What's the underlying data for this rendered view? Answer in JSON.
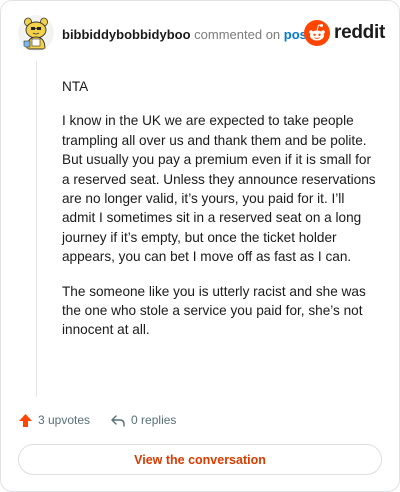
{
  "comment": {
    "username": "bibbiddybobbidyboo",
    "action_text": "commented on",
    "post_link": "post",
    "paragraphs": [
      "NTA",
      "I know in the UK we are expected to take people trampling all over us and thank them and be polite. But usually you pay a premium even if it is small for a reserved seat. Unless they announce reservations are no longer valid, it’s yours, you paid for it. I’ll admit I sometimes sit in a reserved seat on a long journey if it’s empty, but once the ticket holder appears, you can bet I move off as fast as I can.",
      "The someone like you is utterly racist and she was the one who stole a service you paid for, she’s not innocent at all."
    ]
  },
  "brand": {
    "wordmark": "reddit",
    "color": "#ff4500"
  },
  "actions": {
    "upvotes": "3 upvotes",
    "replies": "0 replies"
  },
  "button": {
    "label": "View the conversation"
  },
  "icons": {
    "avatar": "snoo-avatar-icon",
    "logo": "reddit-logo-icon",
    "upvote": "upvote-arrow-icon",
    "reply": "reply-arrow-icon"
  },
  "colors": {
    "link": "#0079d3",
    "upvote": "#ff4500",
    "button_text": "#d93a00"
  }
}
